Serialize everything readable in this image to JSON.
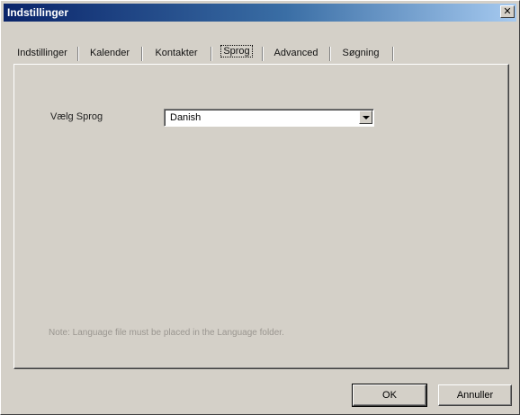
{
  "window": {
    "title": "Indstillinger",
    "close_glyph": "✕"
  },
  "tabs": [
    {
      "label": "Indstillinger"
    },
    {
      "label": "Kalender"
    },
    {
      "label": "Kontakter"
    },
    {
      "label": "Sprog",
      "active": true
    },
    {
      "label": "Advanced"
    },
    {
      "label": "Søgning"
    }
  ],
  "language": {
    "label": "Vælg Sprog",
    "selected": "Danish"
  },
  "note": "Note: Language file must be placed in the Language folder.",
  "buttons": {
    "ok": "OK",
    "cancel": "Annuller"
  },
  "colors": {
    "face": "#d4d0c8",
    "title_start": "#0a246a",
    "title_end": "#a6caf0",
    "note_text": "#9a9690"
  },
  "icons": {
    "close": "close-icon",
    "dropdown": "chevron-down-icon"
  }
}
